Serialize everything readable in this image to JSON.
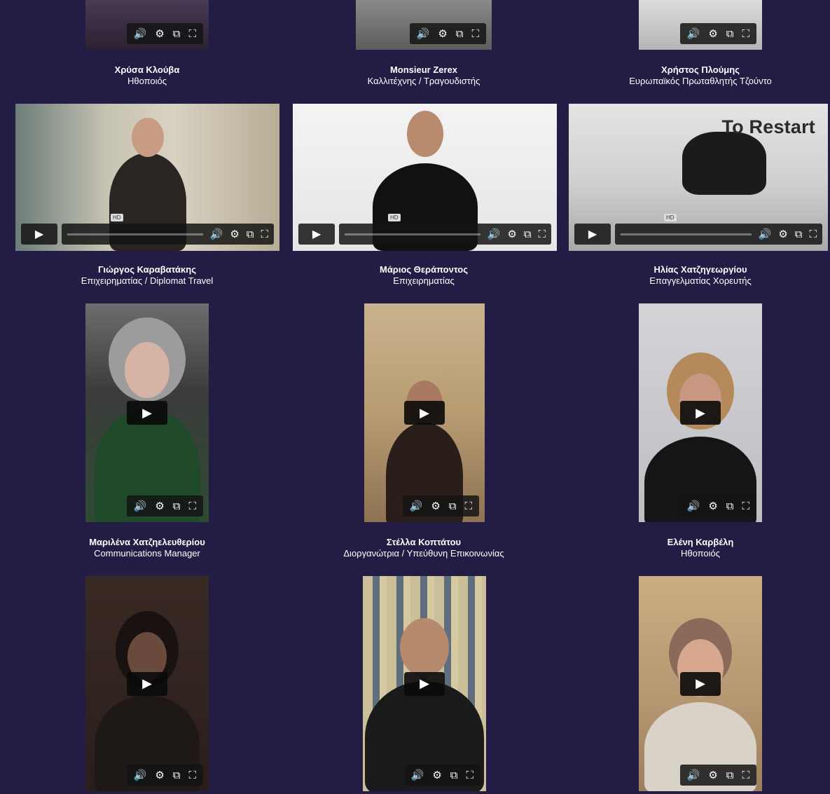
{
  "colors": {
    "background": "#231c45",
    "control_bg": "#141414",
    "text": "#ffffff"
  },
  "icons": {
    "play": "▶",
    "volume": "🔊",
    "settings": "⚙",
    "pip": "⧉",
    "fullscreen": "⛶"
  },
  "row1": [
    {
      "name": "Χρύσα Κλούβα",
      "role": "Ηθοποιός"
    },
    {
      "name": "Monsieur Zerex",
      "role": "Καλλιτέχνης / Τραγουδιστής"
    },
    {
      "name": "Χρήστος Πλούμης",
      "role": "Ευρωπαϊκός Πρωταθλητής Τζούντο"
    }
  ],
  "row2": [
    {
      "name": "Γιώργος Καραβατάκης",
      "role": "Επιχειρηματίας / Diplomat Travel",
      "badge": "HD"
    },
    {
      "name": "Μάριος Θεράποντος",
      "role": "Επιχειρηματίας",
      "badge": "HD"
    },
    {
      "name": "Ηλίας Χατζηγεωργίου",
      "role": "Επαγγελματίας Χορευτής",
      "badge": "HD",
      "overlay": "To Restart"
    }
  ],
  "row3": [
    {
      "name": "Μαριλένα Χατζηελευθερίου",
      "role": "Communications Manager"
    },
    {
      "name": "Στέλλα Κοπτάτου",
      "role": "Διοργανώτρια / Υπεύθυνη Επικοινωνίας"
    },
    {
      "name": "Ελένη Καρβέλη",
      "role": "Ηθοποιός"
    }
  ]
}
